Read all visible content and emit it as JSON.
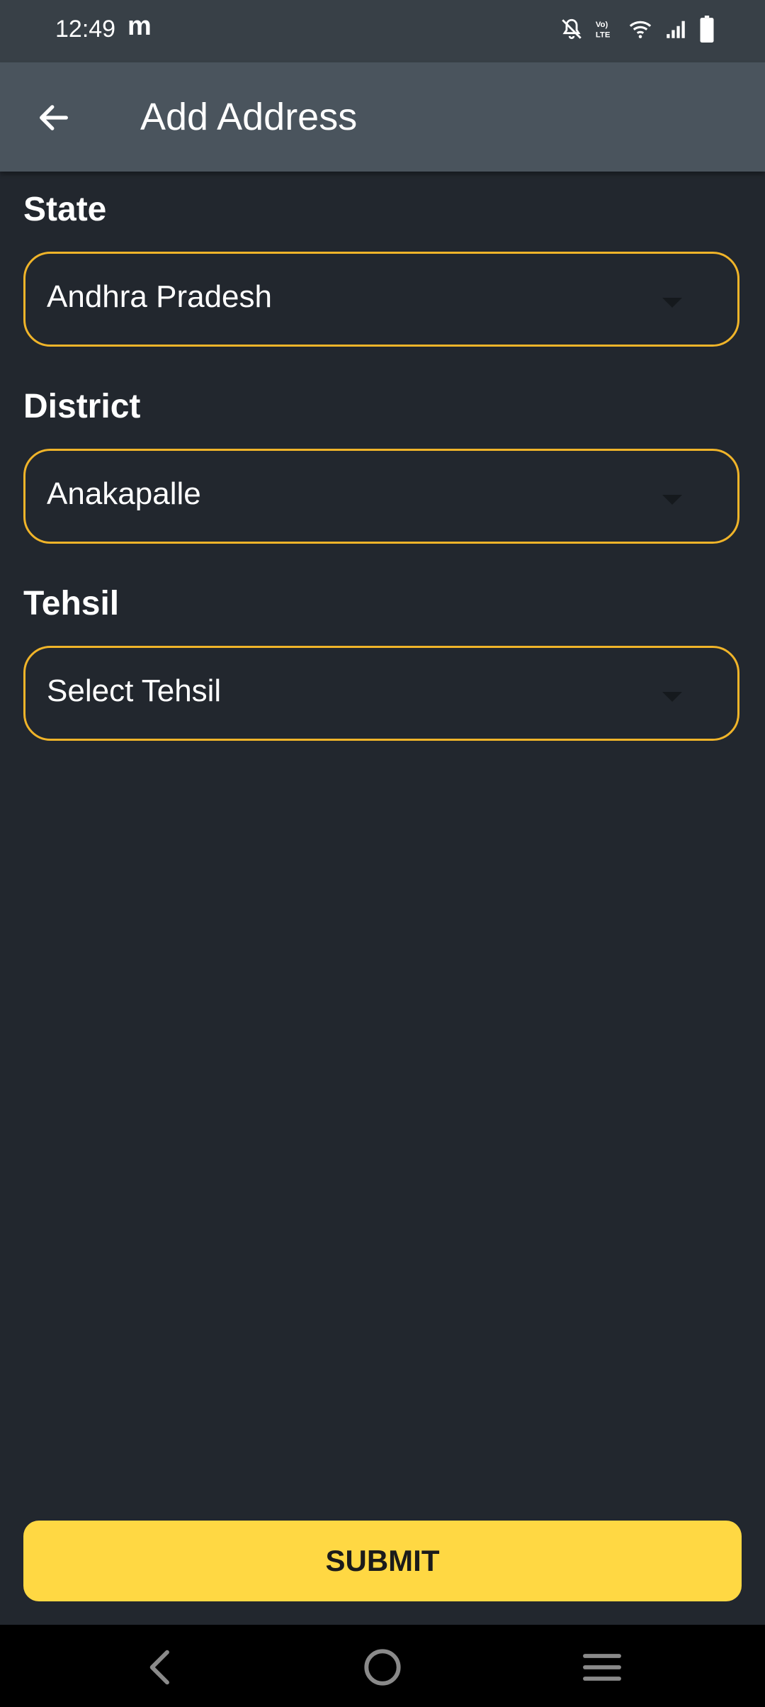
{
  "status_bar": {
    "time": "12:49",
    "app_badge": "m",
    "icons": [
      "bell-off-icon",
      "volte-icon",
      "wifi-icon",
      "signal-icon",
      "battery-icon"
    ]
  },
  "app_bar": {
    "title": "Add Address",
    "back_icon": "arrow-left-icon"
  },
  "form": {
    "state": {
      "label": "State",
      "value": "Andhra Pradesh"
    },
    "district": {
      "label": "District",
      "value": "Anakapalle"
    },
    "tehsil": {
      "label": "Tehsil",
      "value": "Select Tehsil"
    }
  },
  "submit": {
    "label": "SUBMIT"
  },
  "nav_bar": {
    "icons": [
      "back-icon",
      "home-icon",
      "recents-icon"
    ]
  },
  "colors": {
    "background": "#22272e",
    "app_bar": "#4a545d",
    "status_bar": "#384047",
    "accent_border": "#f0b429",
    "submit_button": "#ffd843"
  }
}
